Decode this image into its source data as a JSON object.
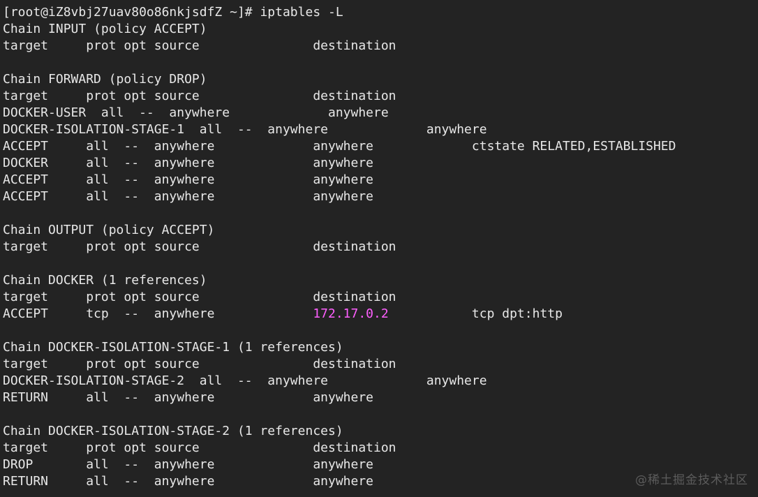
{
  "terminal": {
    "background_color": "#232323",
    "foreground_color": "#e8e8e8",
    "highlight_color": "#ff5fff",
    "prompt": "[root@iZ8vbj27uav80o86nkjsdfZ ~]# ",
    "command": "iptables -L",
    "prompt_line": "[root@iZ8vbj27uav80o86nkjsdfZ ~]# iptables -L",
    "column_header": "target     prot opt source               destination         ",
    "lines": [
      {
        "text": "[root@iZ8vbj27uav80o86nkjsdfZ ~]# iptables -L"
      },
      {
        "text": "Chain INPUT (policy ACCEPT)"
      },
      {
        "text": "target     prot opt source               destination"
      },
      {
        "text": ""
      },
      {
        "text": "Chain FORWARD (policy DROP)"
      },
      {
        "text": "target     prot opt source               destination"
      },
      {
        "text": "DOCKER-USER  all  --  anywhere             anywhere"
      },
      {
        "text": "DOCKER-ISOLATION-STAGE-1  all  --  anywhere             anywhere"
      },
      {
        "text": "ACCEPT     all  --  anywhere             anywhere             ctstate RELATED,ESTABLISHED"
      },
      {
        "text": "DOCKER     all  --  anywhere             anywhere"
      },
      {
        "text": "ACCEPT     all  --  anywhere             anywhere"
      },
      {
        "text": "ACCEPT     all  --  anywhere             anywhere"
      },
      {
        "text": ""
      },
      {
        "text": "Chain OUTPUT (policy ACCEPT)"
      },
      {
        "text": "target     prot opt source               destination"
      },
      {
        "text": ""
      },
      {
        "text": "Chain DOCKER (1 references)"
      },
      {
        "text": "target     prot opt source               destination"
      },
      {
        "segments": [
          {
            "text": "ACCEPT     tcp  --  anywhere             ",
            "color": "default"
          },
          {
            "text": "172.17.0.2",
            "color": "magenta"
          },
          {
            "text": "           tcp dpt:http",
            "color": "default"
          }
        ]
      },
      {
        "text": ""
      },
      {
        "text": "Chain DOCKER-ISOLATION-STAGE-1 (1 references)"
      },
      {
        "text": "target     prot opt source               destination"
      },
      {
        "text": "DOCKER-ISOLATION-STAGE-2  all  --  anywhere             anywhere"
      },
      {
        "text": "RETURN     all  --  anywhere             anywhere"
      },
      {
        "text": ""
      },
      {
        "text": "Chain DOCKER-ISOLATION-STAGE-2 (1 references)"
      },
      {
        "text": "target     prot opt source               destination"
      },
      {
        "text": "DROP       all  --  anywhere             anywhere"
      },
      {
        "text": "RETURN     all  --  anywhere             anywhere"
      }
    ],
    "chains": [
      {
        "name": "INPUT",
        "policy": "ACCEPT",
        "header": "Chain INPUT (policy ACCEPT)",
        "columns": [
          "target",
          "prot",
          "opt",
          "source",
          "destination"
        ],
        "rules": []
      },
      {
        "name": "FORWARD",
        "policy": "DROP",
        "header": "Chain FORWARD (policy DROP)",
        "columns": [
          "target",
          "prot",
          "opt",
          "source",
          "destination"
        ],
        "rules": [
          {
            "target": "DOCKER-USER",
            "prot": "all",
            "opt": "--",
            "source": "anywhere",
            "destination": "anywhere",
            "extra": ""
          },
          {
            "target": "DOCKER-ISOLATION-STAGE-1",
            "prot": "all",
            "opt": "--",
            "source": "anywhere",
            "destination": "anywhere",
            "extra": ""
          },
          {
            "target": "ACCEPT",
            "prot": "all",
            "opt": "--",
            "source": "anywhere",
            "destination": "anywhere",
            "extra": "ctstate RELATED,ESTABLISHED"
          },
          {
            "target": "DOCKER",
            "prot": "all",
            "opt": "--",
            "source": "anywhere",
            "destination": "anywhere",
            "extra": ""
          },
          {
            "target": "ACCEPT",
            "prot": "all",
            "opt": "--",
            "source": "anywhere",
            "destination": "anywhere",
            "extra": ""
          },
          {
            "target": "ACCEPT",
            "prot": "all",
            "opt": "--",
            "source": "anywhere",
            "destination": "anywhere",
            "extra": ""
          }
        ]
      },
      {
        "name": "OUTPUT",
        "policy": "ACCEPT",
        "header": "Chain OUTPUT (policy ACCEPT)",
        "columns": [
          "target",
          "prot",
          "opt",
          "source",
          "destination"
        ],
        "rules": []
      },
      {
        "name": "DOCKER",
        "policy": "",
        "header": "Chain DOCKER (1 references)",
        "references": "1 references",
        "columns": [
          "target",
          "prot",
          "opt",
          "source",
          "destination"
        ],
        "rules": [
          {
            "target": "ACCEPT",
            "prot": "tcp",
            "opt": "--",
            "source": "anywhere",
            "destination": "172.17.0.2",
            "destination_color": "#ff5fff",
            "extra": "tcp dpt:http"
          }
        ]
      },
      {
        "name": "DOCKER-ISOLATION-STAGE-1",
        "policy": "",
        "header": "Chain DOCKER-ISOLATION-STAGE-1 (1 references)",
        "references": "1 references",
        "columns": [
          "target",
          "prot",
          "opt",
          "source",
          "destination"
        ],
        "rules": [
          {
            "target": "DOCKER-ISOLATION-STAGE-2",
            "prot": "all",
            "opt": "--",
            "source": "anywhere",
            "destination": "anywhere",
            "extra": ""
          },
          {
            "target": "RETURN",
            "prot": "all",
            "opt": "--",
            "source": "anywhere",
            "destination": "anywhere",
            "extra": ""
          }
        ]
      },
      {
        "name": "DOCKER-ISOLATION-STAGE-2",
        "policy": "",
        "header": "Chain DOCKER-ISOLATION-STAGE-2 (1 references)",
        "references": "1 references",
        "columns": [
          "target",
          "prot",
          "opt",
          "source",
          "destination"
        ],
        "rules": [
          {
            "target": "DROP",
            "prot": "all",
            "opt": "--",
            "source": "anywhere",
            "destination": "anywhere",
            "extra": ""
          },
          {
            "target": "RETURN",
            "prot": "all",
            "opt": "--",
            "source": "anywhere",
            "destination": "anywhere",
            "extra": ""
          }
        ]
      }
    ]
  },
  "watermark": {
    "text": "@稀土掘金技术社区",
    "color": "#5c5c5c"
  }
}
